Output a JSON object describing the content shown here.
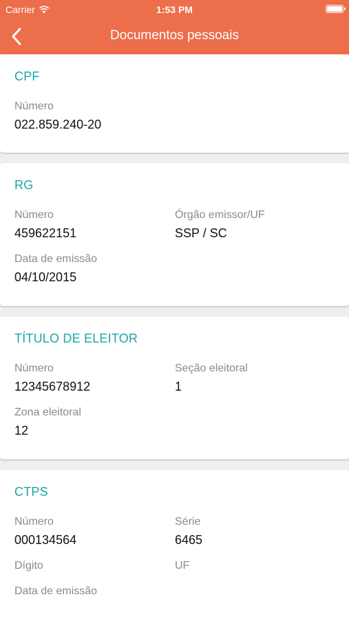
{
  "status_bar": {
    "carrier": "Carrier",
    "time": "1:53 PM"
  },
  "nav": {
    "title": "Documentos pessoais",
    "back_icon": "chevron-left-icon"
  },
  "colors": {
    "accent": "#ec6e4b",
    "section_title": "#1aa6a6"
  },
  "cpf": {
    "title": "CPF",
    "numero_label": "Número",
    "numero_value": "022.859.240-20"
  },
  "rg": {
    "title": "RG",
    "numero_label": "Número",
    "numero_value": "459622151",
    "orgao_label": "Órgão emissor/UF",
    "orgao_value": "SSP / SC",
    "data_label": "Data de emissão",
    "data_value": "04/10/2015"
  },
  "titulo": {
    "title": "TÍTULO DE ELEITOR",
    "numero_label": "Número",
    "numero_value": "12345678912",
    "secao_label": "Seção eleitoral",
    "secao_value": "1",
    "zona_label": "Zona eleitoral",
    "zona_value": "12"
  },
  "ctps": {
    "title": "CTPS",
    "numero_label": "Número",
    "numero_value": "000134564",
    "serie_label": "Série",
    "serie_value": "6465",
    "digito_label": "Dígito",
    "uf_label": "UF",
    "data_label": "Data de emissão"
  }
}
